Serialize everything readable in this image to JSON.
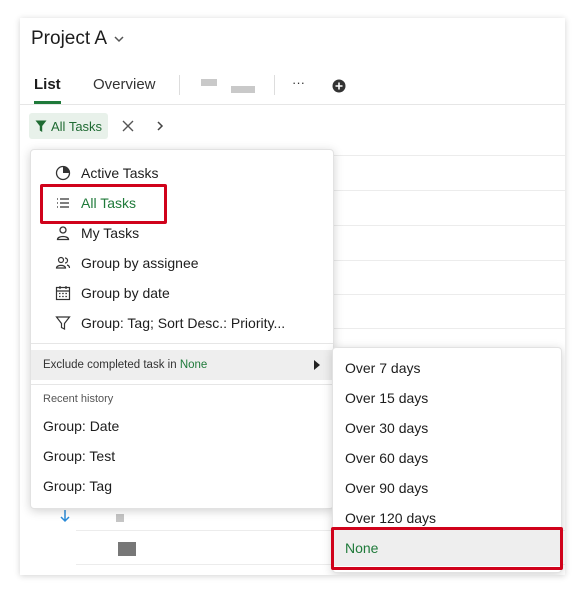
{
  "project": {
    "title": "Project A"
  },
  "tabs": [
    {
      "label": "List",
      "active": true
    },
    {
      "label": "Overview",
      "active": false
    },
    {
      "label": "···",
      "active": false
    }
  ],
  "filter": {
    "label": "All Tasks"
  },
  "views": [
    {
      "label": "Active Tasks",
      "icon": "half-circle-icon"
    },
    {
      "label": "All Tasks",
      "icon": "list-icon",
      "selected": true
    },
    {
      "label": "My Tasks",
      "icon": "person-icon"
    },
    {
      "label": "Group by assignee",
      "icon": "people-icon"
    },
    {
      "label": "Group by date",
      "icon": "calendar-icon"
    },
    {
      "label": "Group: Tag; Sort Desc.: Priority...",
      "icon": "funnel-icon"
    }
  ],
  "exclude": {
    "prefix": "Exclude completed task in",
    "value": "None"
  },
  "recent": {
    "label": "Recent history",
    "items": [
      "Group: Date",
      "Group: Test",
      "Group: Tag"
    ]
  },
  "exclude_options": [
    "Over 7 days",
    "Over 15 days",
    "Over 30 days",
    "Over 60 days",
    "Over 90 days",
    "Over 120 days",
    "None"
  ],
  "colors": {
    "accent": "#1f7a3a",
    "highlight": "#d0021b"
  }
}
